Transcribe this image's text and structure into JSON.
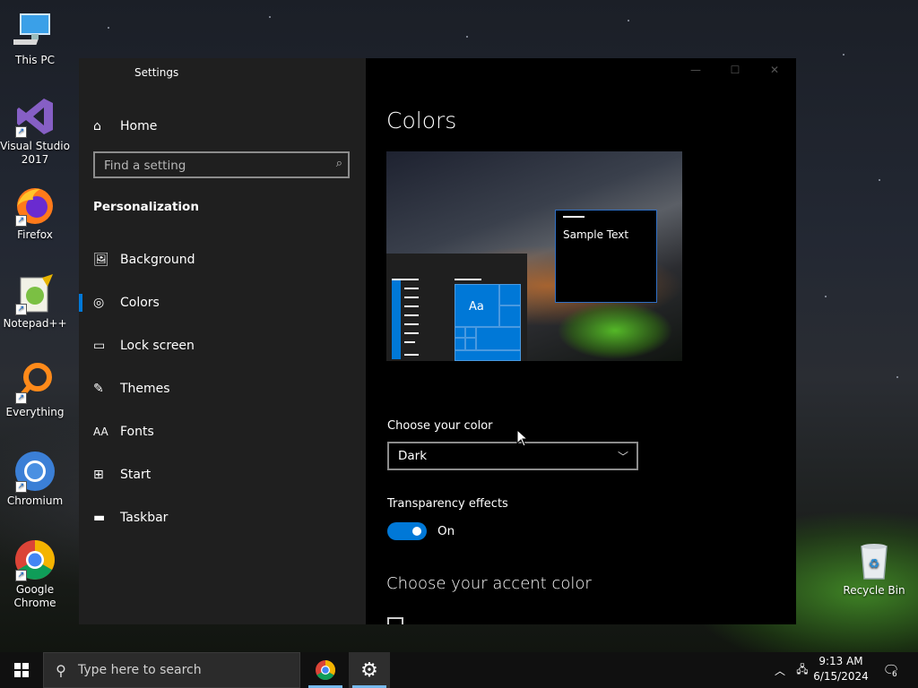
{
  "desktop": {
    "icons": [
      {
        "label": "This PC"
      },
      {
        "label": "Visual Studio 2017"
      },
      {
        "label": "Firefox"
      },
      {
        "label": "Notepad++"
      },
      {
        "label": "Everything"
      },
      {
        "label": "Chromium"
      },
      {
        "label": "Google Chrome"
      },
      {
        "label": "Recycle Bin"
      }
    ]
  },
  "window": {
    "title": "Settings",
    "controls": {
      "minimize": "—",
      "maximize": "☐",
      "close": "✕"
    }
  },
  "sidebar": {
    "home_label": "Home",
    "search_placeholder": "Find a setting",
    "section": "Personalization",
    "items": [
      {
        "label": "Background",
        "icon": "image-icon"
      },
      {
        "label": "Colors",
        "icon": "palette-icon",
        "selected": true
      },
      {
        "label": "Lock screen",
        "icon": "lock-screen-icon"
      },
      {
        "label": "Themes",
        "icon": "themes-icon"
      },
      {
        "label": "Fonts",
        "icon": "fonts-icon"
      },
      {
        "label": "Start",
        "icon": "start-icon"
      },
      {
        "label": "Taskbar",
        "icon": "taskbar-icon"
      }
    ]
  },
  "main": {
    "title": "Colors",
    "preview": {
      "tile_label": "Aa",
      "sample_text": "Sample Text"
    },
    "choose_color_label": "Choose your color",
    "choose_color_value": "Dark",
    "transparency_label": "Transparency effects",
    "transparency_state": "On",
    "accent_heading": "Choose your accent color",
    "accent_color": "#0078d7"
  },
  "taskbar": {
    "search_placeholder": "Type here to search",
    "time": "9:13 AM",
    "date": "6/15/2024",
    "notification_count": "6"
  }
}
